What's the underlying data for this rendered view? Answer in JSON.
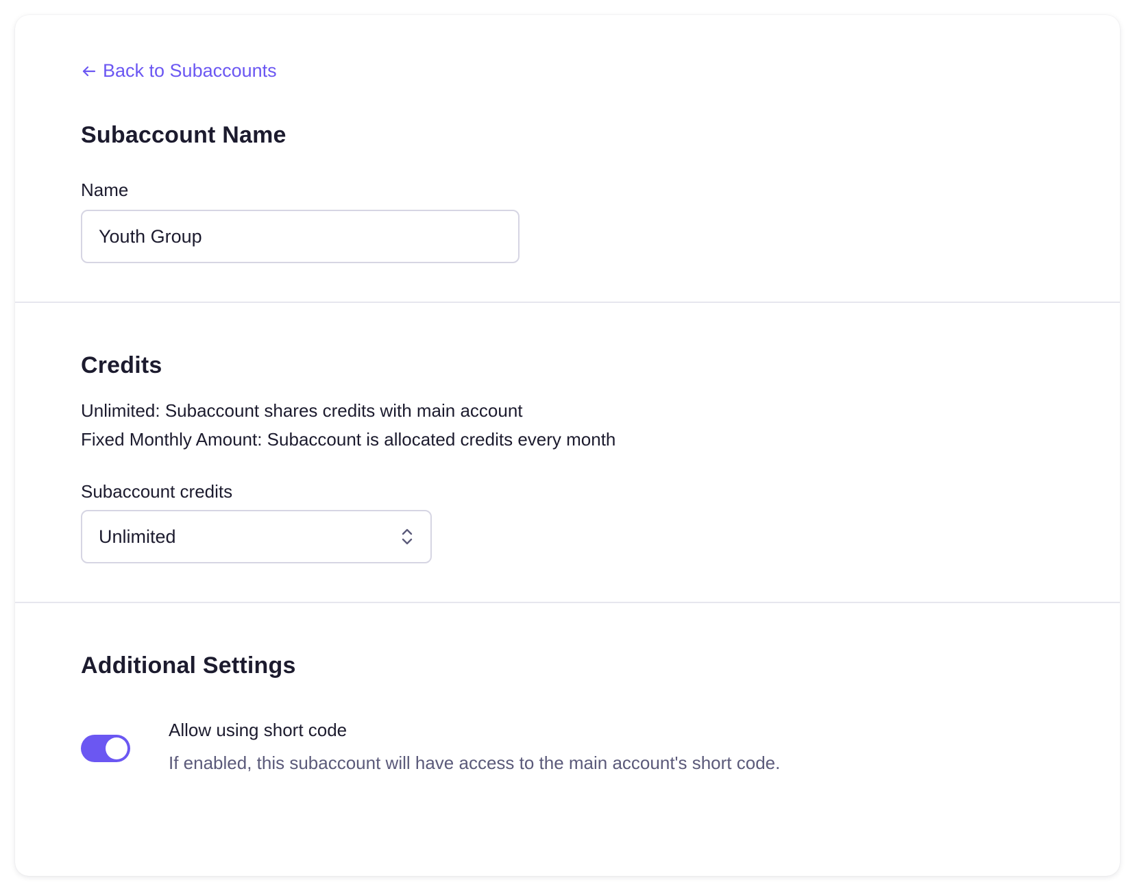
{
  "back_link": {
    "label": "Back to Subaccounts"
  },
  "name_section": {
    "heading": "Subaccount Name",
    "name_label": "Name",
    "name_value": "Youth Group"
  },
  "credits_section": {
    "heading": "Credits",
    "descriptions": [
      "Unlimited: Subaccount shares credits with main account",
      "Fixed Monthly Amount: Subaccount is allocated credits every month"
    ],
    "select_label": "Subaccount credits",
    "select_value": "Unlimited"
  },
  "additional_section": {
    "heading": "Additional Settings",
    "short_code_toggle": {
      "title": "Allow using short code",
      "help": "If enabled, this subaccount will have access to the main account's short code.",
      "enabled": true
    }
  },
  "colors": {
    "accent": "#6b57f2",
    "text": "#1c1b2e",
    "muted_text": "#5b5a7a",
    "border": "#d6d5e3",
    "divider": "#e6e6ee"
  },
  "icons": {
    "back": "arrow-left-icon",
    "select": "chevron-up-down-icon"
  }
}
